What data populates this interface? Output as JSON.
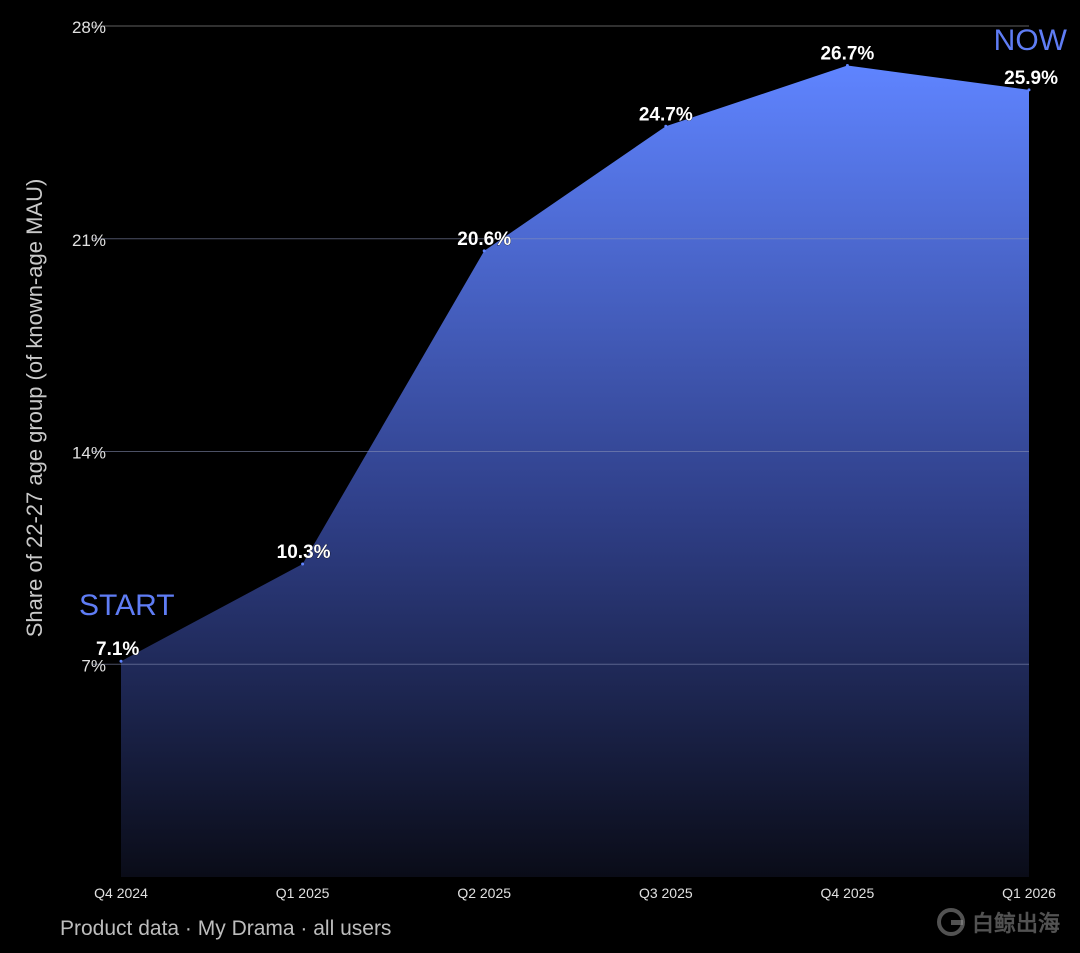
{
  "chart_data": {
    "type": "area",
    "title": "",
    "xlabel": "",
    "ylabel": "Share of 22-27 age group (of known-age MAU)",
    "categories": [
      "Q4 2024",
      "Q1 2025",
      "Q2 2025",
      "Q3 2025",
      "Q4 2025",
      "Q1 2026"
    ],
    "values": [
      7.1,
      10.3,
      20.6,
      24.7,
      26.7,
      25.9
    ],
    "data_labels": [
      "7.1%",
      "10.3%",
      "20.6%",
      "24.7%",
      "26.7%",
      "25.9%"
    ],
    "ylim": [
      0,
      28
    ],
    "yticks": [
      7,
      14,
      21,
      28
    ],
    "ytick_labels": [
      "7%",
      "14%",
      "21%",
      "28%"
    ],
    "grid": "horizontal",
    "annotations": [
      {
        "text": "START",
        "category": "Q4 2024"
      },
      {
        "text": "NOW",
        "category": "Q1 2026"
      }
    ],
    "colors": {
      "area_top": "#5f84ff",
      "area_bottom": "#0a0c18",
      "annotation": "#5f7df5",
      "label": "#ffffff",
      "grid": "#5a5a5a",
      "tick": "#e0e0e0",
      "background": "#000000"
    }
  },
  "footer": "Product data · My Drama · all users",
  "watermark": {
    "text": "白鲸出海",
    "icon": "whale-logo-icon"
  }
}
